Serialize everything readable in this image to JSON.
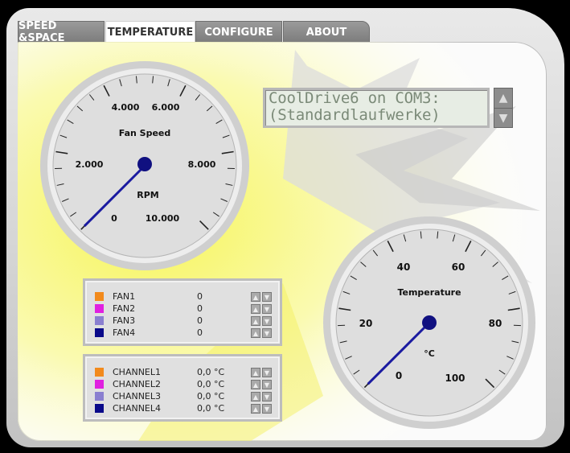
{
  "tabs": [
    {
      "label": "SPEED &SPACE",
      "active": false
    },
    {
      "label": "TEMPERATURE",
      "active": true
    },
    {
      "label": "CONFIGURE",
      "active": false
    },
    {
      "label": "ABOUT",
      "active": false
    }
  ],
  "lcd": {
    "line1": "CoolDrive6 on COM3:",
    "line2": "(Standardlaufwerke)",
    "up_icon": "up-arrow-icon",
    "down_icon": "down-arrow-icon"
  },
  "fan_gauge": {
    "title": "Fan Speed",
    "unit": "RPM",
    "tick_labels": [
      "0",
      "2.000",
      "4.000",
      "6.000",
      "8.000",
      "10.000"
    ],
    "value": 0
  },
  "temp_gauge": {
    "title": "Temperature",
    "unit": "°C",
    "tick_labels": [
      "0",
      "20",
      "40",
      "60",
      "80",
      "100"
    ],
    "value": 0
  },
  "fans": [
    {
      "name": "FAN1",
      "value": "0",
      "color": "#f28a1c"
    },
    {
      "name": "FAN2",
      "value": "0",
      "color": "#e020e0"
    },
    {
      "name": "FAN3",
      "value": "0",
      "color": "#8a7fd0"
    },
    {
      "name": "FAN4",
      "value": "0",
      "color": "#0a0a8a"
    }
  ],
  "channels": [
    {
      "name": "CHANNEL1",
      "value": "0,0 °C",
      "color": "#f28a1c"
    },
    {
      "name": "CHANNEL2",
      "value": "0,0 °C",
      "color": "#e020e0"
    },
    {
      "name": "CHANNEL3",
      "value": "0,0 °C",
      "color": "#8a7fd0"
    },
    {
      "name": "CHANNEL4",
      "value": "0,0 °C",
      "color": "#0a0a8a"
    }
  ],
  "colors": {
    "needle": "#1a1aa0",
    "accent_yellow": "#f2f03a"
  }
}
